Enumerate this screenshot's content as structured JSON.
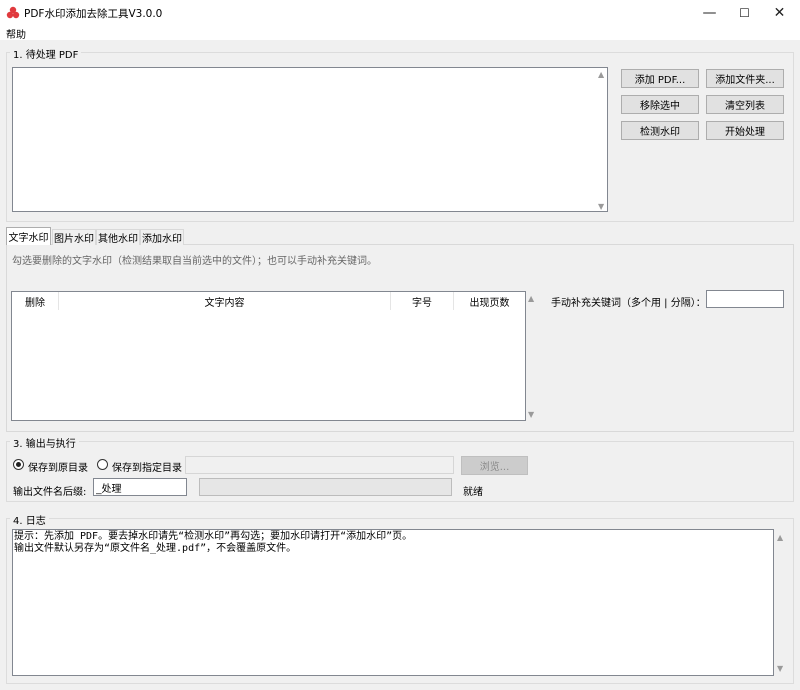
{
  "window": {
    "title": "PDF水印添加去除工具V3.0.0",
    "minimize": "—",
    "maximize": "☐",
    "close": "✕"
  },
  "menu": {
    "help": "帮助"
  },
  "section1": {
    "title": "1. 待处理 PDF",
    "buttons": {
      "add_pdf": "添加 PDF...",
      "add_folder": "添加文件夹...",
      "remove_selected": "移除选中",
      "clear_list": "清空列表",
      "detect_watermark": "检测水印",
      "start_process": "开始处理"
    }
  },
  "tabs": [
    "文字水印",
    "图片水印",
    "其他水印",
    "添加水印"
  ],
  "text_tab": {
    "hint": "勾选要删除的文字水印（检测结果取自当前选中的文件）；也可以手动补充关键词。",
    "columns": [
      "删除",
      "文字内容",
      "字号",
      "出现页数"
    ],
    "keyword_label": "手动补充关键词（多个用 | 分隔）：",
    "keyword_value": ""
  },
  "section3": {
    "title": "3. 输出与执行",
    "radio_original": "保存到原目录",
    "radio_custom": "保存到指定目录",
    "browse": "浏览...",
    "suffix_label": "输出文件名后缀:",
    "suffix_value": "_处理",
    "status": "就绪"
  },
  "section4": {
    "title": "4. 日志",
    "log": "提示：先添加 PDF。要去掉水印请先“检测水印”再勾选；要加水印请打开“添加水印”页。\n输出文件默认另存为“原文件名_处理.pdf”，不会覆盖原文件。"
  },
  "colors": {
    "app_icon": "#e03a3e",
    "panel": "#f0f0f0",
    "field_border": "#828790"
  }
}
